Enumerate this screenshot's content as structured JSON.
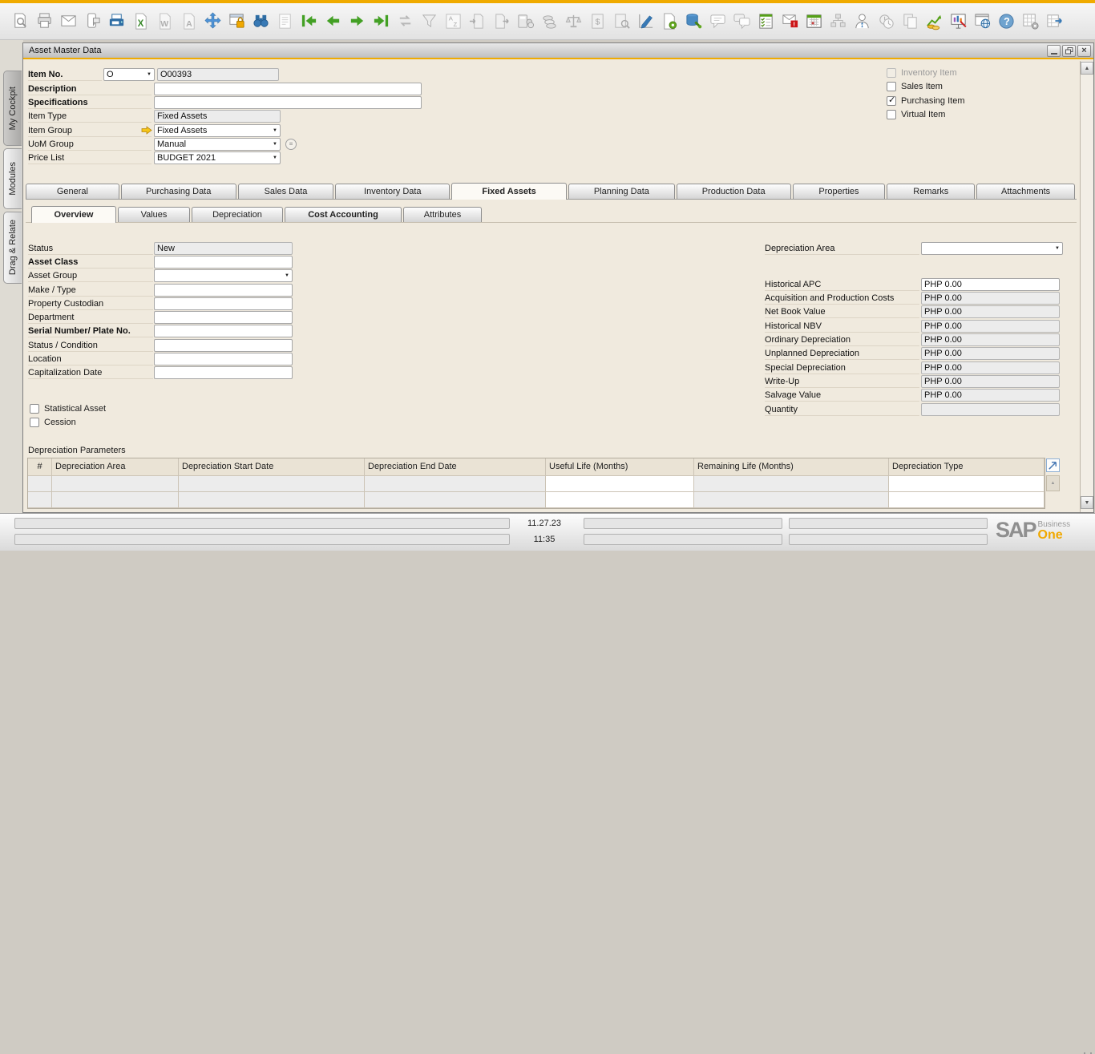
{
  "toolbar": {
    "icons": [
      "print-preview",
      "print",
      "send-email",
      "send-sms",
      "send-fax",
      "export-excel",
      "export-word",
      "export-pdf",
      "navigate",
      "lock-screen",
      "find",
      "journal-entry",
      "first-record",
      "previous-record",
      "next-record",
      "last-record",
      "refresh-record",
      "filter-table",
      "sort-table",
      "copy-from",
      "copy-to",
      "payment-means",
      "payment-wizard",
      "gross-profit",
      "volume-weight",
      "transaction-journal",
      "form-settings",
      "document-settings",
      "query-manager",
      "remarks",
      "opportunities",
      "activity",
      "alerts",
      "calendar",
      "org-chart",
      "employee-master",
      "recurring-transactions",
      "related-documents",
      "cash-flow",
      "pickers-display",
      "web-browser",
      "online-help",
      "settings-grid",
      "exit-grid"
    ]
  },
  "window": {
    "title": "Asset Master Data"
  },
  "dock": {
    "active": "My Cockpit",
    "tabs": [
      "My Cockpit",
      "Modules",
      "Drag & Relate"
    ]
  },
  "header": {
    "item_no_label": "Item No.",
    "item_series": "O",
    "item_no_value": "O00393",
    "description_label": "Description",
    "description_value": "",
    "specifications_label": "Specifications",
    "specifications_value": "",
    "item_type_label": "Item Type",
    "item_type_value": "Fixed Assets",
    "item_group_label": "Item Group",
    "item_group_value": "Fixed Assets",
    "uom_group_label": "UoM Group",
    "uom_group_value": "Manual",
    "price_list_label": "Price List",
    "price_list_value": "BUDGET 2021",
    "item_flags": [
      {
        "label": "Inventory Item",
        "checked": false,
        "disabled": true
      },
      {
        "label": "Sales Item",
        "checked": false,
        "disabled": false
      },
      {
        "label": "Purchasing Item",
        "checked": true,
        "disabled": false
      },
      {
        "label": "Virtual Item",
        "checked": false,
        "disabled": false
      }
    ]
  },
  "main_tabs": {
    "active": "Fixed Assets",
    "items": [
      "General",
      "Purchasing Data",
      "Sales Data",
      "Inventory Data",
      "Fixed Assets",
      "Planning Data",
      "Production Data",
      "Properties",
      "Remarks",
      "Attachments"
    ]
  },
  "sub_tabs": {
    "active": "Overview",
    "items": [
      "Overview",
      "Values",
      "Depreciation",
      "Cost Accounting",
      "Attributes"
    ]
  },
  "overview": {
    "left_fields": [
      {
        "label": "Status",
        "value": "New"
      },
      {
        "label": "Asset Class",
        "value": ""
      },
      {
        "label": "Asset Group",
        "value": ""
      },
      {
        "label": "Make / Type",
        "value": ""
      },
      {
        "label": "Property Custodian",
        "value": ""
      },
      {
        "label": "Department",
        "value": ""
      },
      {
        "label": "Serial Number/ Plate No.",
        "value": ""
      },
      {
        "label": "Status / Condition",
        "value": ""
      },
      {
        "label": "Location",
        "value": ""
      },
      {
        "label": "Capitalization Date",
        "value": ""
      }
    ],
    "depreciation_area_label": "Depreciation Area",
    "depreciation_area_value": "",
    "right_fields": [
      {
        "label": "Historical APC",
        "value": "PHP 0.00"
      },
      {
        "label": "Acquisition and Production Costs",
        "value": "PHP 0.00"
      },
      {
        "label": "Net Book Value",
        "value": "PHP 0.00"
      },
      {
        "label": "Historical NBV",
        "value": "PHP 0.00"
      },
      {
        "label": "Ordinary Depreciation",
        "value": "PHP 0.00"
      },
      {
        "label": "Unplanned Depreciation",
        "value": "PHP 0.00"
      },
      {
        "label": "Special Depreciation",
        "value": "PHP 0.00"
      },
      {
        "label": "Write-Up",
        "value": "PHP 0.00"
      },
      {
        "label": "Salvage Value",
        "value": "PHP 0.00"
      },
      {
        "label": "Quantity",
        "value": ""
      }
    ],
    "flags": [
      {
        "label": "Statistical Asset",
        "checked": false
      },
      {
        "label": "Cession",
        "checked": false
      }
    ],
    "table": {
      "title": "Depreciation Parameters",
      "columns": [
        "#",
        "Depreciation Area",
        "Depreciation Start Date",
        "Depreciation End Date",
        "Useful Life (Months)",
        "Remaining Life (Months)",
        "Depreciation Type"
      ],
      "rows": [
        [
          "",
          "",
          "",
          "",
          "",
          "",
          ""
        ],
        [
          "",
          "",
          "",
          "",
          "",
          "",
          ""
        ]
      ]
    }
  },
  "statusbar": {
    "date": "11.27.23",
    "time": "11:35",
    "brand": {
      "sap": "SAP",
      "business": "Business",
      "one": "One"
    }
  },
  "colors": {
    "accent_gold": "#F0AB00",
    "content_bg": "#F0EADE",
    "brand_orange": "#F0A800"
  }
}
